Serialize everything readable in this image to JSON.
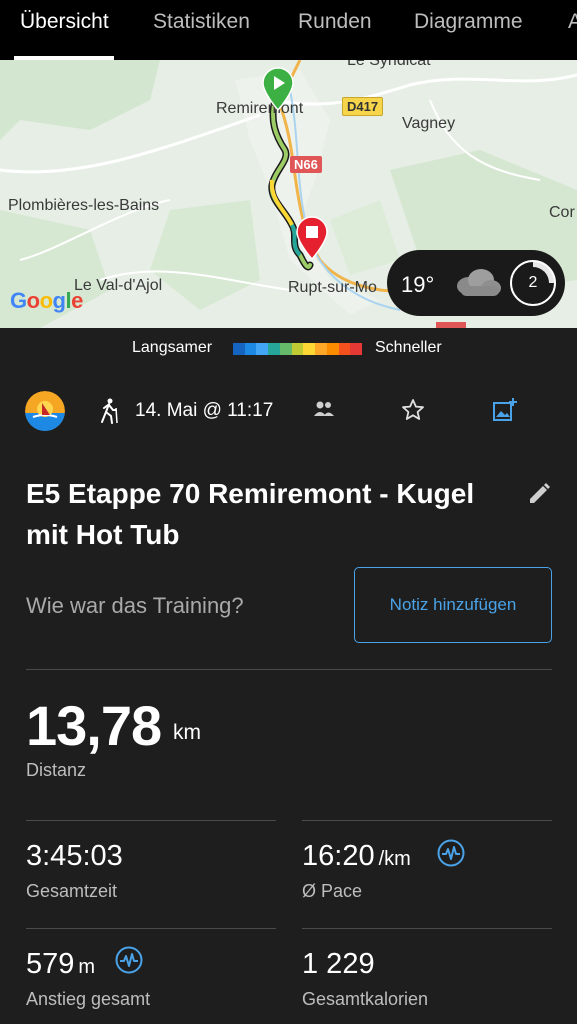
{
  "tabs": [
    "Übersicht",
    "Statistiken",
    "Runden",
    "Diagramme",
    "A"
  ],
  "map": {
    "places": [
      "Le Syndicat",
      "Remiremont",
      "Vagney",
      "Plombières-les-Bains",
      "Cor",
      "Le Val-d'Ajol",
      "Rupt-sur-Mo"
    ],
    "roads": [
      "D417",
      "N66"
    ],
    "attribution": "Google",
    "weather": {
      "temperature": "19°",
      "icon": "cloud-icon",
      "badge": "2"
    }
  },
  "legend": {
    "slower": "Langsamer",
    "faster": "Schneller",
    "colors": [
      "#1565c0",
      "#1e88e5",
      "#42a5f5",
      "#26a69a",
      "#66bb6a",
      "#c0ca33",
      "#fdd835",
      "#ffa726",
      "#fb8c00",
      "#f4511e",
      "#e53935"
    ]
  },
  "activity": {
    "date": "14. Mai @ 11:17",
    "title": "E5 Etappe 70 Remiremont - Kugel mit Hot Tub",
    "question": "Wie war das Training?",
    "note_button": "Notiz hinzufügen"
  },
  "distance": {
    "value": "13,78",
    "unit": "km",
    "label": "Distanz"
  },
  "stats": {
    "total_time": {
      "value": "3:45:03",
      "label": "Gesamtzeit"
    },
    "pace": {
      "value": "16:20",
      "unit": "/km",
      "label": "Ø Pace"
    },
    "ascent": {
      "value": "579",
      "unit": "m",
      "label": "Anstieg gesamt"
    },
    "calories": {
      "value": "1 229",
      "label": "Gesamtkalorien"
    }
  },
  "colors": {
    "accent": "#4aa3e8",
    "route_start": "#3cb043",
    "route_end": "#e5212f"
  }
}
